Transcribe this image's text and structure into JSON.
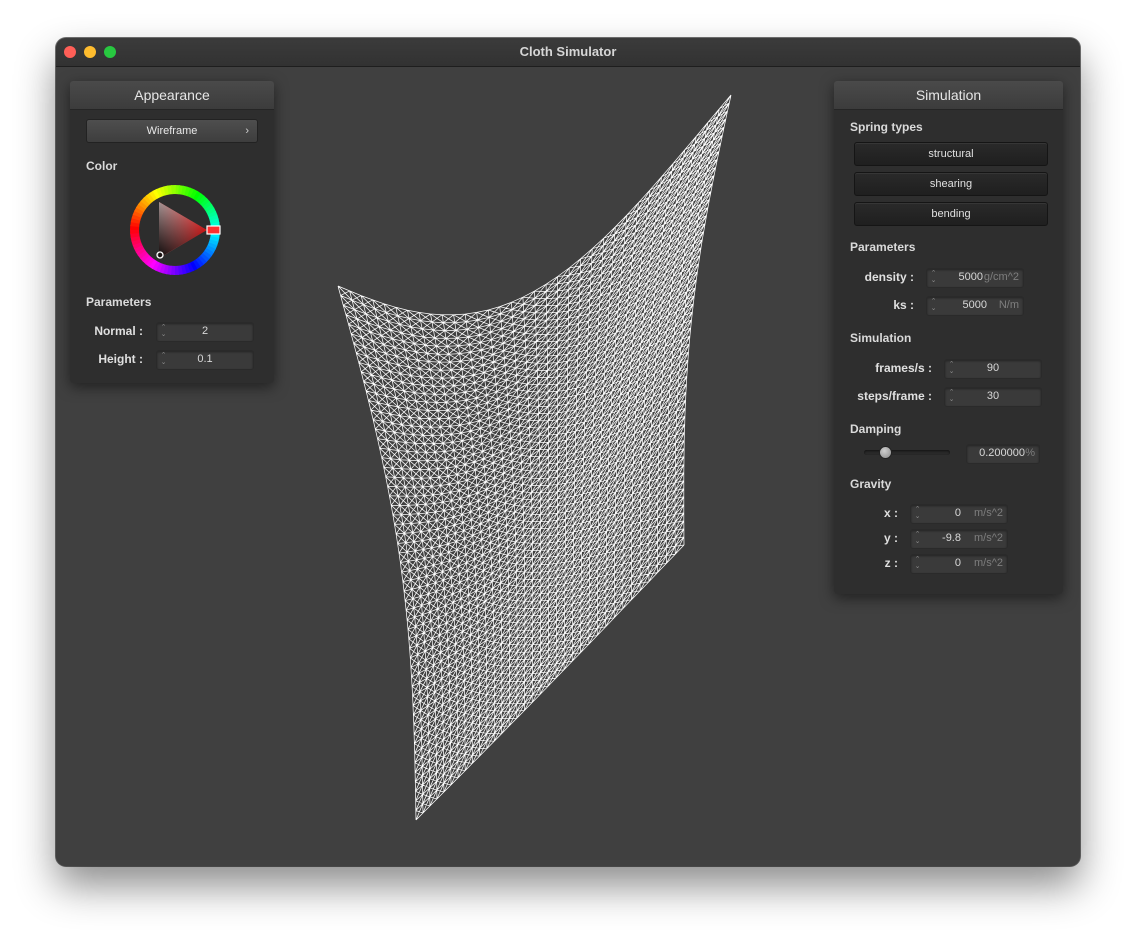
{
  "window": {
    "title": "Cloth Simulator"
  },
  "appearance": {
    "title": "Appearance",
    "shader": {
      "selected": "Wireframe"
    },
    "color_label": "Color",
    "params_label": "Parameters",
    "normal": {
      "label": "Normal :",
      "value": "2"
    },
    "height": {
      "label": "Height :",
      "value": "0.1"
    },
    "wheel_color": "#ff3333"
  },
  "simulation": {
    "title": "Simulation",
    "spring_label": "Spring types",
    "springs": [
      "structural",
      "shearing",
      "bending"
    ],
    "params_label": "Parameters",
    "density": {
      "label": "density :",
      "value": "5000",
      "unit": "g/cm^2"
    },
    "ks": {
      "label": "ks :",
      "value": "5000",
      "unit": "N/m"
    },
    "sim_label": "Simulation",
    "fps": {
      "label": "frames/s :",
      "value": "90"
    },
    "steps": {
      "label": "steps/frame :",
      "value": "30"
    },
    "damping_label": "Damping",
    "damping": {
      "value": "0.200000",
      "unit": "%",
      "fraction": 0.2
    },
    "gravity_label": "Gravity",
    "gravity": [
      {
        "label": "x :",
        "value": "0",
        "unit": "m/s^2"
      },
      {
        "label": "y :",
        "value": "-9.8",
        "unit": "m/s^2"
      },
      {
        "label": "z :",
        "value": "0",
        "unit": "m/s^2"
      }
    ]
  },
  "cloth": {
    "color": "#ffffff",
    "background": "#404040",
    "rows": 56,
    "cols": 34
  }
}
